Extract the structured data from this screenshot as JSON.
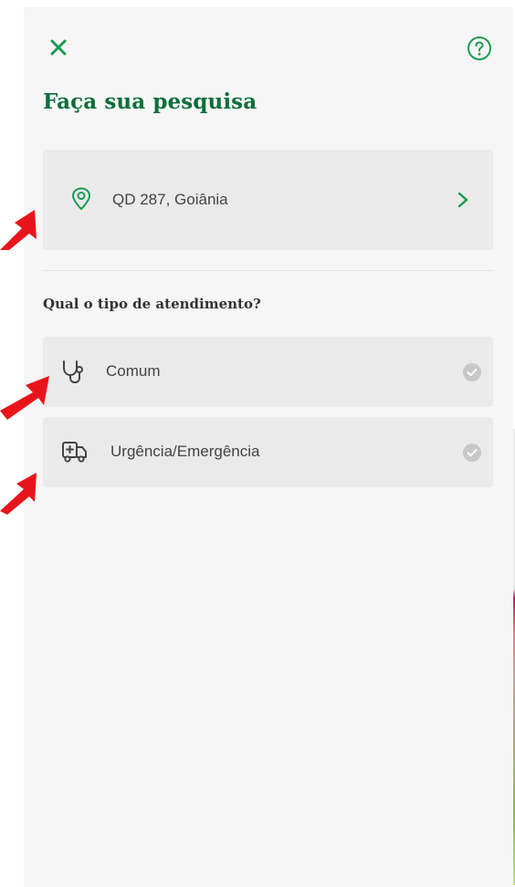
{
  "header": {
    "close_icon": "close-icon",
    "help_icon": "help-icon",
    "title": "Faça sua pesquisa"
  },
  "location": {
    "icon": "location-pin-icon",
    "text": "QD 287, Goiânia",
    "chevron_icon": "chevron-right-icon"
  },
  "question": "Qual o tipo de atendimento?",
  "options": [
    {
      "label": "Comum",
      "icon": "stethoscope-icon",
      "selected": false
    },
    {
      "label": "Urgência/Emergência",
      "icon": "ambulance-icon",
      "selected": false
    }
  ],
  "colors": {
    "accent": "#0b6e3b",
    "icon_green": "#1a9a55",
    "card_bg": "#eaeaea",
    "panel_bg": "#f6f6f6",
    "check_gray": "#c8c8c8",
    "annotation_red": "#e8141b"
  }
}
